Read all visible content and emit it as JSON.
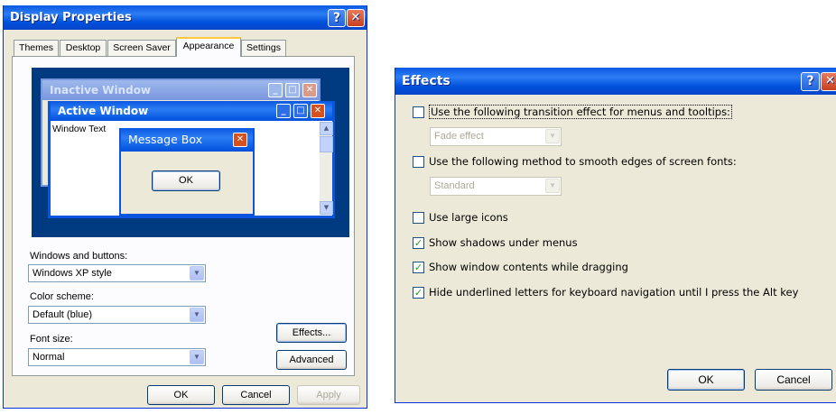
{
  "display_properties": {
    "title": "Display Properties",
    "tabs": [
      "Themes",
      "Desktop",
      "Screen Saver",
      "Appearance",
      "Settings"
    ],
    "active_tab": "Appearance",
    "preview": {
      "inactive_title": "Inactive Window",
      "active_title": "Active Window",
      "window_text": "Window Text",
      "message_box_title": "Message Box",
      "ok_label": "OK"
    },
    "windows_buttons": {
      "label": "Windows and buttons:",
      "value": "Windows XP style"
    },
    "color_scheme": {
      "label": "Color scheme:",
      "value": "Default (blue)"
    },
    "font_size": {
      "label": "Font size:",
      "value": "Normal"
    },
    "effects_button": "Effects...",
    "advanced_button": "Advanced",
    "ok_button": "OK",
    "cancel_button": "Cancel",
    "apply_button": "Apply"
  },
  "effects": {
    "title": "Effects",
    "options": [
      {
        "label": "Use the following transition effect for menus and tooltips:",
        "checked": false
      },
      {
        "label": "Use the following method to smooth edges of screen fonts:",
        "checked": false
      },
      {
        "label": "Use large icons",
        "checked": false
      },
      {
        "label": "Show shadows under menus",
        "checked": true
      },
      {
        "label": "Show window contents while dragging",
        "checked": true
      },
      {
        "label": "Hide underlined letters for keyboard navigation until I press the Alt key",
        "checked": true
      }
    ],
    "transition_value": "Fade effect",
    "smoothing_value": "Standard",
    "ok_button": "OK",
    "cancel_button": "Cancel"
  },
  "colors": {
    "titlebar": "#0a58e2",
    "dialog_bg": "#ece9d8",
    "preview_bg": "#003a81",
    "checkmark": "#21a121"
  }
}
